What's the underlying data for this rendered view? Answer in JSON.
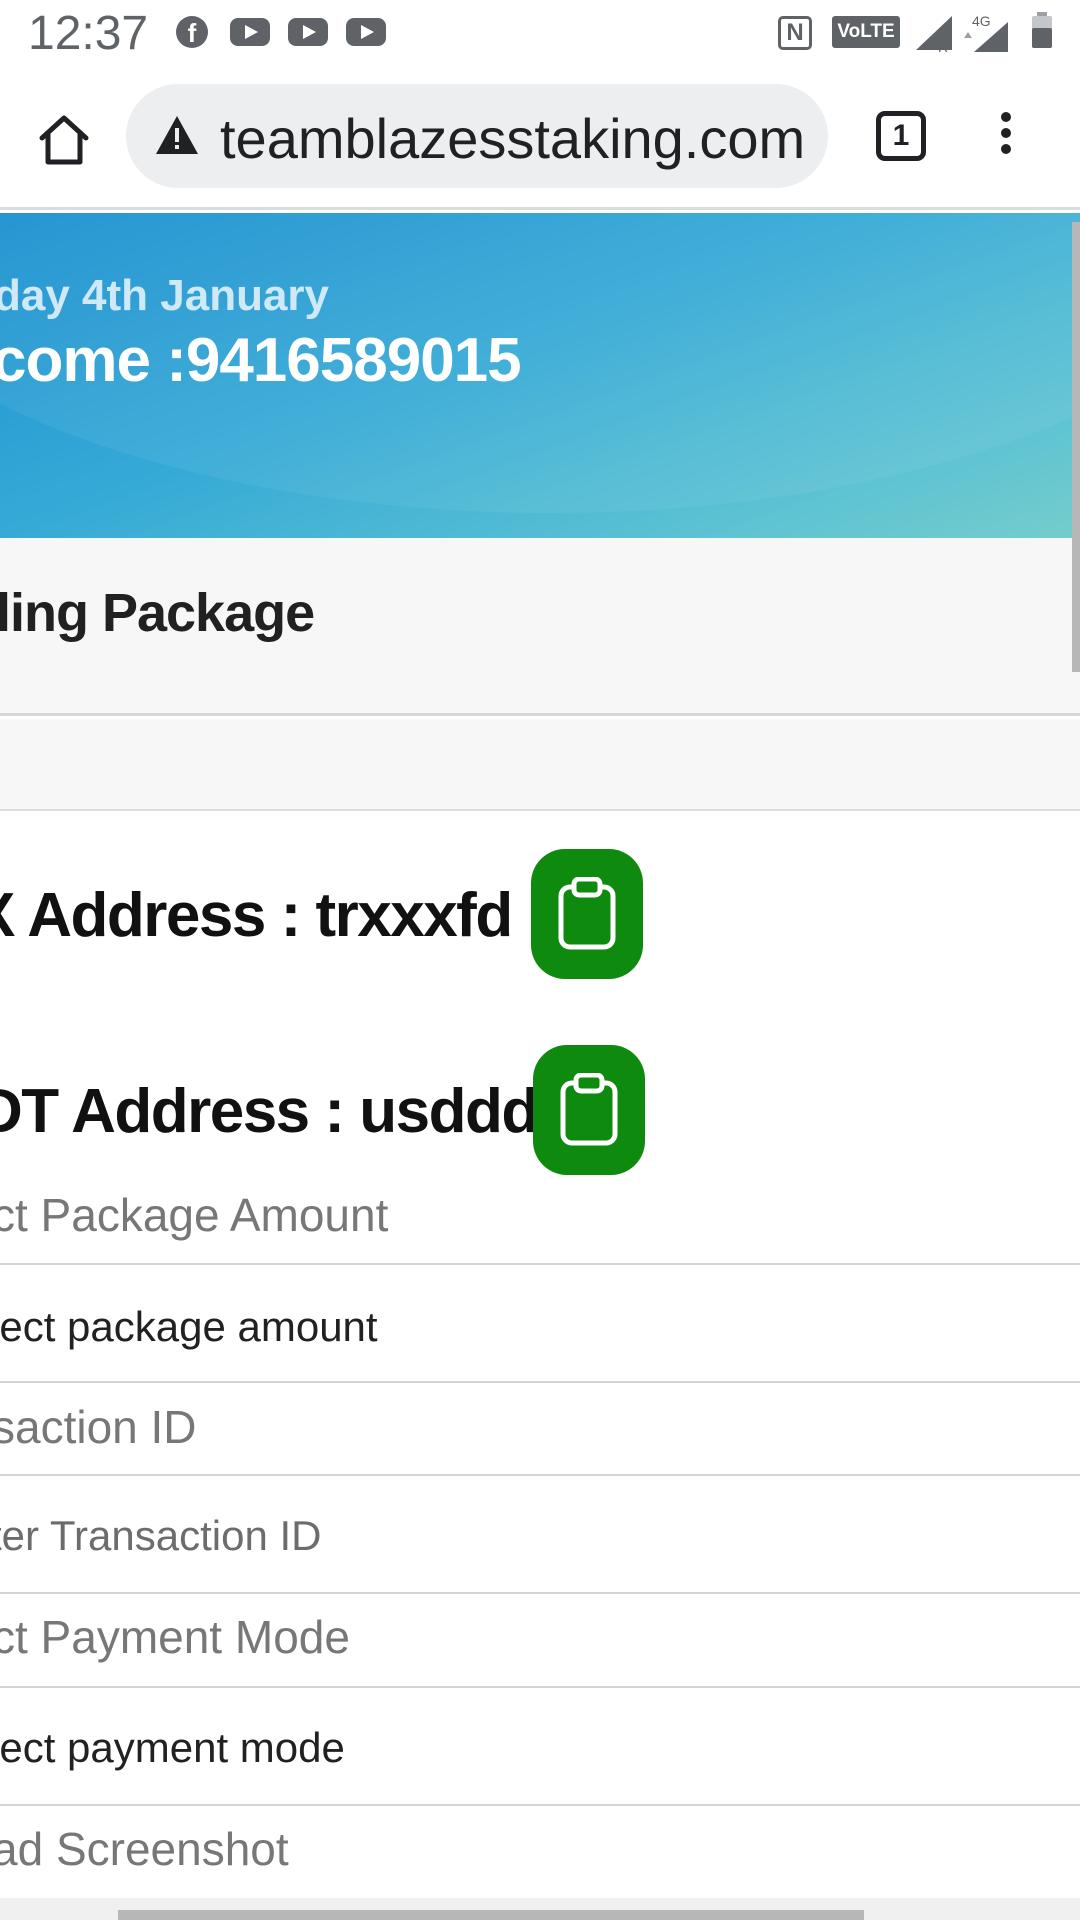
{
  "status_bar": {
    "time": "12:37",
    "notification_icons": [
      "facebook-icon",
      "youtube-icon",
      "youtube-icon",
      "youtube-icon"
    ],
    "volte_label": "VoLTE",
    "network_label": "4G",
    "roaming_label": "R"
  },
  "browser": {
    "url": "teamblazesstaking.com",
    "tab_count": "1"
  },
  "hero": {
    "date_text": "day 4th January",
    "income_text": "come :9416589015"
  },
  "section": {
    "title": "ling Package"
  },
  "addresses": [
    {
      "label": "X Address : trxxxfd"
    },
    {
      "label": "DT Address : usddd"
    }
  ],
  "form": {
    "package_label": "ct Package Amount",
    "package_select": "lect package amount",
    "txn_label": "saction ID",
    "txn_placeholder": "ter Transaction ID",
    "payment_label": "ct Payment Mode",
    "payment_select": "lect payment mode",
    "upload_label": "ad Screenshot"
  },
  "colors": {
    "copy_button": "#0e8a0e",
    "hero_gradient_start": "#1a8fd0",
    "hero_gradient_end": "#74cdcc"
  }
}
